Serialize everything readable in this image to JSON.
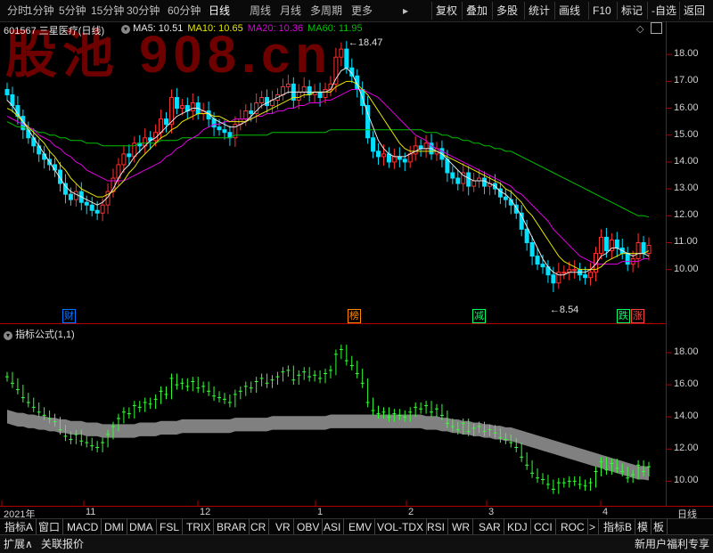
{
  "toolbar": {
    "periods": [
      "分时",
      "1分钟",
      "5分钟",
      "15分钟",
      "30分钟",
      "60分钟",
      "日线",
      "周线",
      "月线",
      "多周期",
      "更多"
    ],
    "active_period": "日线",
    "buttons": [
      "复权",
      "叠加",
      "多股",
      "统计",
      "画线",
      "F10",
      "标记",
      "-自选",
      "返回"
    ]
  },
  "watermark": "股池 908.cn",
  "stock": {
    "code": "601567",
    "name": "三星医疗(日线)"
  },
  "ma_labels": [
    {
      "text": "MA5: 10.51",
      "color": "#e8e8e8"
    },
    {
      "text": "MA10: 10.65",
      "color": "#e6e600"
    },
    {
      "text": "MA20: 10.36",
      "color": "#e000e0"
    },
    {
      "text": "MA60: 11.95",
      "color": "#00c000"
    }
  ],
  "main_axis": [
    "18.00",
    "17.00",
    "16.00",
    "15.00",
    "14.00",
    "13.00",
    "12.00",
    "11.00",
    "10.00"
  ],
  "annotations": {
    "high": "18.47",
    "low": "8.54"
  },
  "events": [
    {
      "label": "财",
      "color": "#0077ff",
      "bg": "#000"
    },
    {
      "label": "榜",
      "color": "#ff8800",
      "bg": "#000"
    },
    {
      "label": "减",
      "color": "#00ff66",
      "bg": "#000"
    },
    {
      "label": "跌",
      "color": "#00ff66",
      "bg": "#000"
    },
    {
      "label": "涨",
      "color": "#ff4444",
      "bg": "#000"
    }
  ],
  "sub_header": "指标公式(1,1)",
  "sub_axis": [
    "18.00",
    "16.00",
    "14.00",
    "12.00",
    "10.00"
  ],
  "dates": [
    "2021年",
    "11",
    "12",
    "1",
    "2",
    "3",
    "4"
  ],
  "date_right": "日线",
  "indicator_tabs": [
    "指标A",
    "窗口",
    "MACD",
    "DMI",
    "DMA",
    "FSL",
    "TRIX",
    "BRAR",
    "CR",
    "VR",
    "OBV",
    "ASI",
    "EMV",
    "VOL-TDX",
    "RSI",
    "WR",
    "SAR",
    "KDJ",
    "CCI",
    "ROC",
    ">",
    "指标B",
    "模",
    "板"
  ],
  "status_left": [
    "扩展∧",
    "关联报价"
  ],
  "status_right": "新用户福利专享",
  "colors": {
    "up": "#ff3030",
    "down": "#00e0ff",
    "ma5": "#e8e8e8",
    "ma10": "#e6e600",
    "ma20": "#e000e0",
    "ma60": "#00c000",
    "sub_candle": "#33ff33",
    "band": "#808080",
    "grid": "#b00000"
  },
  "chart_data": {
    "type": "candlestick",
    "y_range": [
      8.3,
      18.9
    ],
    "closes": [
      16.5,
      16.1,
      15.7,
      15.2,
      14.9,
      14.6,
      14.3,
      14.1,
      13.9,
      13.7,
      13.2,
      12.8,
      12.6,
      12.9,
      12.5,
      12.4,
      12.2,
      12.1,
      12.4,
      12.9,
      13.4,
      13.9,
      14.3,
      14.2,
      14.7,
      14.6,
      14.9,
      14.8,
      15.1,
      15.6,
      15.4,
      16.4,
      16.0,
      16.1,
      15.9,
      16.2,
      15.8,
      15.9,
      15.6,
      15.3,
      15.2,
      15.1,
      14.9,
      15.4,
      15.6,
      15.9,
      15.8,
      16.2,
      16.4,
      16.1,
      16.3,
      16.5,
      16.8,
      16.9,
      16.3,
      16.6,
      16.8,
      16.5,
      16.6,
      16.4,
      16.7,
      16.9,
      17.9,
      18.2,
      17.5,
      17.2,
      16.7,
      16.1,
      14.9,
      14.4,
      14.2,
      14.3,
      14.0,
      14.2,
      14.1,
      14.0,
      14.3,
      14.6,
      14.5,
      14.7,
      14.3,
      14.5,
      14.1,
      13.6,
      13.4,
      13.2,
      13.6,
      13.1,
      13.3,
      13.4,
      13.1,
      13.2,
      13.0,
      12.7,
      12.6,
      12.4,
      12.1,
      11.5,
      11.0,
      10.5,
      10.2,
      10.1,
      9.8,
      9.5,
      9.9,
      9.9,
      10.0,
      10.0,
      9.8,
      9.7,
      9.9,
      10.6,
      11.2,
      10.7,
      11.1,
      10.8,
      10.6,
      10.2,
      10.4,
      11.0,
      10.6,
      10.9
    ],
    "ma5": [
      16.3,
      16.1,
      15.8,
      15.5,
      15.2,
      14.9,
      14.6,
      14.3,
      14.0,
      13.7,
      13.4,
      13.1,
      12.9,
      12.8,
      12.7,
      12.6,
      12.5,
      12.4,
      12.5,
      12.7,
      13.0,
      13.4,
      13.7,
      13.9,
      14.2,
      14.4,
      14.6,
      14.8,
      14.9,
      15.1,
      15.3,
      15.5,
      15.7,
      15.8,
      15.9,
      16.0,
      16.0,
      15.9,
      15.8,
      15.6,
      15.5,
      15.4,
      15.3,
      15.3,
      15.4,
      15.5,
      15.7,
      15.9,
      16.1,
      16.2,
      16.3,
      16.4,
      16.5,
      16.6,
      16.6,
      16.6,
      16.6,
      16.6,
      16.6,
      16.6,
      16.6,
      16.7,
      17.1,
      17.4,
      17.5,
      17.3,
      16.9,
      16.4,
      15.8,
      15.3,
      14.8,
      14.5,
      14.3,
      14.2,
      14.2,
      14.2,
      14.3,
      14.4,
      14.5,
      14.5,
      14.5,
      14.4,
      14.3,
      14.1,
      13.9,
      13.7,
      13.5,
      13.4,
      13.3,
      13.3,
      13.3,
      13.2,
      13.1,
      12.9,
      12.8,
      12.6,
      12.3,
      12.0,
      11.6,
      11.2,
      10.8,
      10.4,
      10.1,
      9.9,
      9.8,
      9.8,
      9.9,
      9.9,
      9.9,
      9.9,
      10.0,
      10.2,
      10.5,
      10.6,
      10.8,
      10.8,
      10.7,
      10.6,
      10.5,
      10.6,
      10.6,
      10.5
    ],
    "ma10": [
      16.0,
      15.9,
      15.7,
      15.5,
      15.3,
      15.1,
      14.9,
      14.7,
      14.4,
      14.2,
      13.9,
      13.7,
      13.4,
      13.2,
      13.0,
      12.9,
      12.8,
      12.7,
      12.7,
      12.8,
      12.9,
      13.1,
      13.3,
      13.6,
      13.8,
      14.1,
      14.3,
      14.5,
      14.7,
      14.9,
      15.0,
      15.2,
      15.3,
      15.5,
      15.6,
      15.7,
      15.8,
      15.8,
      15.8,
      15.7,
      15.7,
      15.6,
      15.5,
      15.5,
      15.5,
      15.5,
      15.6,
      15.7,
      15.8,
      15.9,
      16.0,
      16.1,
      16.2,
      16.3,
      16.4,
      16.4,
      16.5,
      16.5,
      16.6,
      16.6,
      16.6,
      16.6,
      16.8,
      16.9,
      17.0,
      17.0,
      16.9,
      16.7,
      16.5,
      16.2,
      15.9,
      15.6,
      15.3,
      15.0,
      14.7,
      14.5,
      14.4,
      14.4,
      14.4,
      14.4,
      14.4,
      14.4,
      14.3,
      14.2,
      14.1,
      14.0,
      13.9,
      13.8,
      13.7,
      13.6,
      13.5,
      13.4,
      13.3,
      13.2,
      13.0,
      12.9,
      12.7,
      12.5,
      12.2,
      12.0,
      11.7,
      11.4,
      11.1,
      10.8,
      10.5,
      10.3,
      10.2,
      10.1,
      10.0,
      10.0,
      10.0,
      10.0,
      10.1,
      10.3,
      10.4,
      10.5,
      10.6,
      10.6,
      10.6,
      10.6,
      10.6,
      10.7
    ],
    "ma20": [
      15.7,
      15.6,
      15.5,
      15.4,
      15.3,
      15.2,
      15.0,
      14.9,
      14.8,
      14.6,
      14.5,
      14.3,
      14.2,
      14.0,
      13.9,
      13.7,
      13.6,
      13.5,
      13.4,
      13.3,
      13.3,
      13.3,
      13.3,
      13.4,
      13.5,
      13.6,
      13.7,
      13.8,
      13.9,
      14.0,
      14.2,
      14.3,
      14.5,
      14.6,
      14.8,
      14.9,
      15.0,
      15.2,
      15.3,
      15.4,
      15.4,
      15.5,
      15.5,
      15.6,
      15.6,
      15.6,
      15.6,
      15.7,
      15.7,
      15.8,
      15.8,
      15.9,
      15.9,
      16.0,
      16.0,
      16.1,
      16.1,
      16.2,
      16.2,
      16.2,
      16.3,
      16.3,
      16.4,
      16.5,
      16.6,
      16.7,
      16.7,
      16.7,
      16.6,
      16.5,
      16.4,
      16.2,
      16.0,
      15.8,
      15.6,
      15.4,
      15.2,
      15.0,
      14.9,
      14.8,
      14.6,
      14.5,
      14.4,
      14.3,
      14.2,
      14.1,
      14.0,
      13.9,
      13.8,
      13.7,
      13.6,
      13.5,
      13.4,
      13.3,
      13.2,
      13.1,
      12.9,
      12.8,
      12.6,
      12.4,
      12.2,
      12.0,
      11.8,
      11.5,
      11.3,
      11.1,
      10.9,
      10.7,
      10.5,
      10.4,
      10.3,
      10.2,
      10.2,
      10.2,
      10.2,
      10.2,
      10.3,
      10.3,
      10.3,
      10.3,
      10.4,
      10.4
    ],
    "ma60": [
      15.5,
      15.4,
      15.3,
      15.3,
      15.2,
      15.2,
      15.1,
      15.1,
      15.0,
      15.0,
      14.9,
      14.9,
      14.8,
      14.8,
      14.8,
      14.7,
      14.7,
      14.7,
      14.6,
      14.6,
      14.6,
      14.6,
      14.6,
      14.6,
      14.6,
      14.7,
      14.7,
      14.7,
      14.7,
      14.8,
      14.8,
      14.8,
      14.8,
      14.9,
      14.9,
      14.9,
      14.9,
      14.9,
      14.9,
      14.9,
      14.9,
      14.9,
      14.9,
      15.0,
      15.0,
      15.0,
      15.0,
      15.0,
      15.0,
      15.0,
      15.1,
      15.1,
      15.1,
      15.1,
      15.1,
      15.1,
      15.1,
      15.1,
      15.1,
      15.1,
      15.1,
      15.2,
      15.2,
      15.2,
      15.2,
      15.2,
      15.2,
      15.2,
      15.2,
      15.2,
      15.2,
      15.2,
      15.2,
      15.2,
      15.2,
      15.2,
      15.2,
      15.2,
      15.2,
      15.1,
      15.1,
      15.1,
      15.0,
      15.0,
      14.9,
      14.9,
      14.8,
      14.8,
      14.7,
      14.7,
      14.6,
      14.6,
      14.5,
      14.5,
      14.4,
      14.4,
      14.3,
      14.2,
      14.1,
      14.0,
      13.9,
      13.8,
      13.7,
      13.6,
      13.5,
      13.4,
      13.3,
      13.2,
      13.1,
      13.0,
      12.9,
      12.8,
      12.7,
      12.6,
      12.5,
      12.4,
      12.3,
      12.2,
      12.1,
      12.0,
      12.0,
      11.95
    ]
  }
}
